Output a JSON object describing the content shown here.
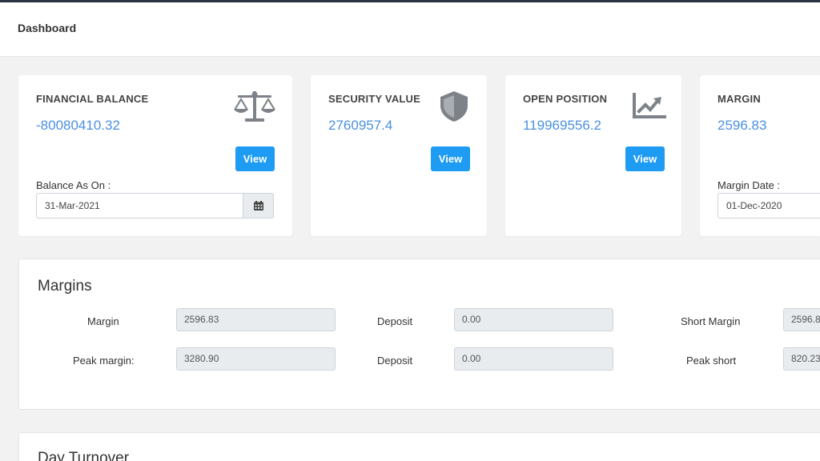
{
  "header": {
    "title": "Dashboard"
  },
  "cards": {
    "financial": {
      "label": "FINANCIAL BALANCE",
      "value": "-80080410.32",
      "view_label": "View",
      "date_label": "Balance As On :",
      "date_value": "31-Mar-2021",
      "icon": "scale-icon"
    },
    "security": {
      "label": "SECURITY VALUE",
      "value": "2760957.4",
      "view_label": "View",
      "icon": "shield-icon"
    },
    "open": {
      "label": "OPEN POSITION",
      "value": "119969556.2",
      "view_label": "View",
      "icon": "chart-line-icon"
    },
    "margin": {
      "label": "MARGIN",
      "value": "2596.83",
      "date_label": "Margin Date :",
      "date_value": "01-Dec-2020"
    }
  },
  "margins": {
    "title": "Margins",
    "row1": {
      "margin_label": "Margin",
      "margin_value": "2596.83",
      "deposit_label": "Deposit",
      "deposit_value": "0.00",
      "short_label": "Short Margin",
      "short_value": "2596.8"
    },
    "row2": {
      "peak_label": "Peak margin:",
      "peak_value": "3280.90",
      "deposit_label": "Deposit",
      "deposit_value": "0.00",
      "short_label": "Peak short",
      "short_value": "820.23"
    }
  },
  "turnover": {
    "title": "Day Turnover"
  },
  "colors": {
    "accent": "#1e9bf2",
    "value": "#4a90e2",
    "icon": "#7d8289"
  }
}
